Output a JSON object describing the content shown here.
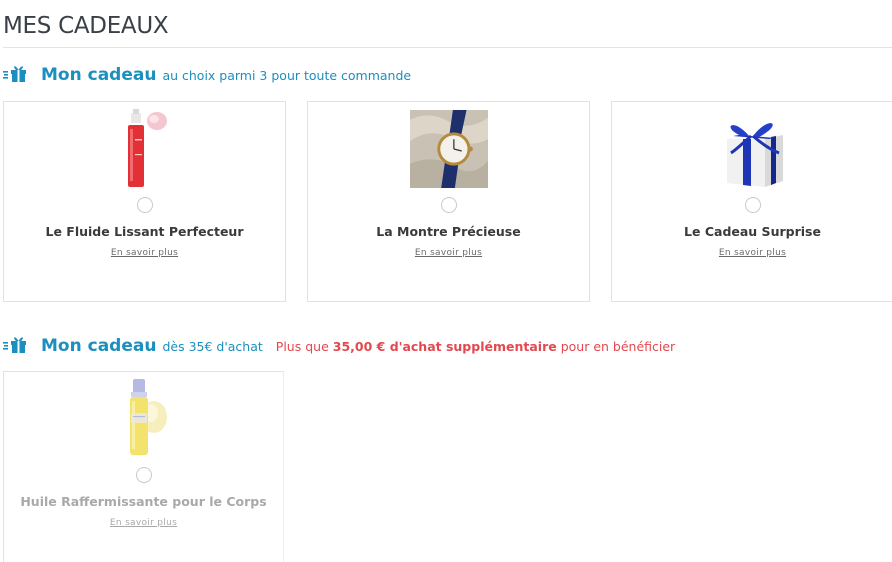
{
  "page": {
    "title": "MES CADEAUX"
  },
  "section1": {
    "title": "Mon cadeau",
    "subtitle": "au choix parmi 3 pour toute commande",
    "gifts": [
      {
        "name": "Le Fluide Lissant Perfecteur",
        "link": "En savoir plus",
        "image": "red-serum-bottle",
        "selected": false
      },
      {
        "name": "La Montre Précieuse",
        "link": "En savoir plus",
        "image": "watch-photo",
        "selected": false
      },
      {
        "name": "Le Cadeau Surprise",
        "link": "En savoir plus",
        "image": "gift-box",
        "selected": false
      }
    ]
  },
  "section2": {
    "title": "Mon cadeau",
    "subtitle": "dès 35€ d'achat",
    "note_prefix": "Plus que",
    "note_amount": "35,00 € d'achat supplémentaire",
    "note_suffix": "pour en bénéficier",
    "gifts": [
      {
        "name": "Huile Raffermissante pour le Corps",
        "link": "En savoir plus",
        "image": "yellow-oil-bottle",
        "selected": false,
        "disabled": true
      }
    ]
  },
  "colors": {
    "accent": "#1b8fbd",
    "alert": "#e4484f",
    "title": "#3a4047",
    "border": "#e2e2e2"
  }
}
